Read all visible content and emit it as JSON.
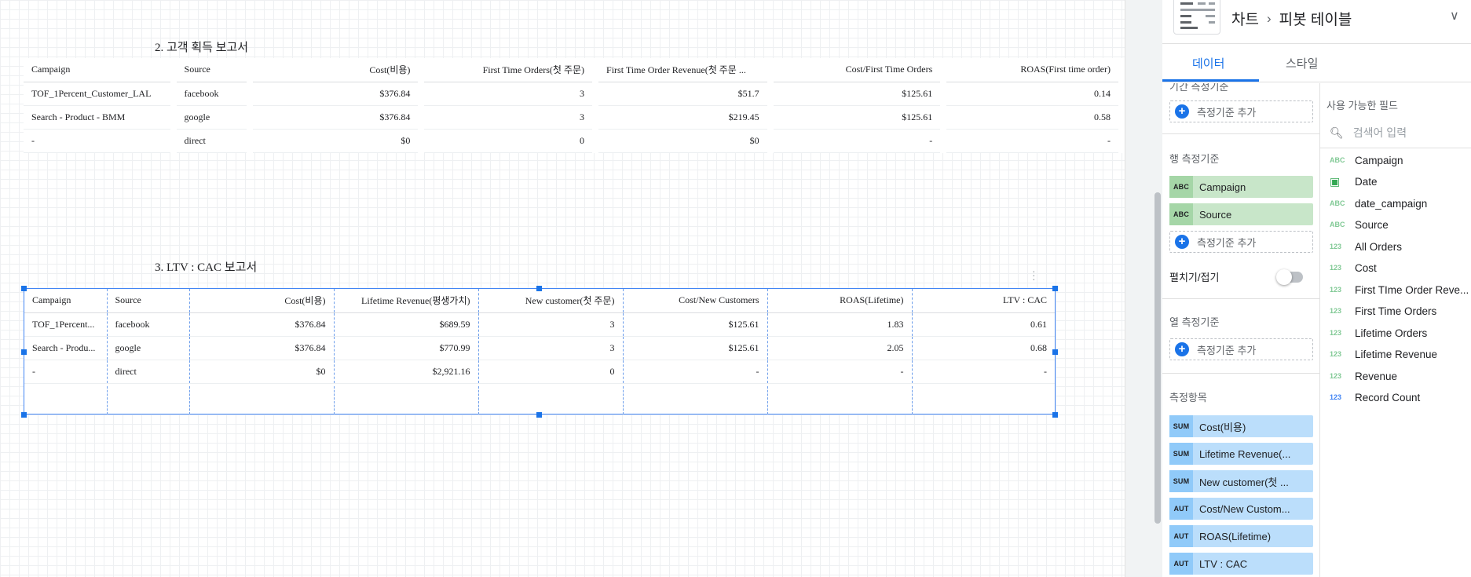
{
  "report2": {
    "title": "2. 고객 획득 보고서",
    "headers": [
      "Campaign",
      "Source",
      "Cost(비용)",
      "First Time Orders(첫 주문)",
      "First Time Order Revenue(첫 주문 ...",
      "Cost/First Time Orders",
      "ROAS(First time order)"
    ],
    "rows": [
      [
        "TOF_1Percent_Customer_LAL",
        "facebook",
        "$376.84",
        "3",
        "$51.7",
        "$125.61",
        "0.14"
      ],
      [
        "Search - Product - BMM",
        "google",
        "$376.84",
        "3",
        "$219.45",
        "$125.61",
        "0.58"
      ],
      [
        "-",
        "direct",
        "$0",
        "0",
        "$0",
        "-",
        "-"
      ]
    ]
  },
  "report3": {
    "title": "3. LTV : CAC 보고서",
    "headers": [
      "Campaign",
      "Source",
      "Cost(비용)",
      "Lifetime Revenue(평생가치)",
      "New customer(첫 주문)",
      "Cost/New Customers",
      "ROAS(Lifetime)",
      "LTV : CAC"
    ],
    "rows": [
      [
        "TOF_1Percent...",
        "facebook",
        "$376.84",
        "$689.59",
        "3",
        "$125.61",
        "1.83",
        "0.61"
      ],
      [
        "Search - Produ...",
        "google",
        "$376.84",
        "$770.99",
        "3",
        "$125.61",
        "2.05",
        "0.68"
      ],
      [
        "-",
        "direct",
        "$0",
        "$2,921.16",
        "0",
        "-",
        "-",
        "-"
      ]
    ]
  },
  "panel": {
    "breadcrumb_chart": "차트",
    "breadcrumb_sep": "›",
    "breadcrumb_type": "피봇 테이블",
    "collapse_icon": "∨",
    "tabs": {
      "data": "데이터",
      "style": "스타일"
    },
    "date_dimension_label": "기간 측정기준",
    "add_dimension": "측정기준 추가",
    "row_dimension_label": "행 측정기준",
    "row_dimensions": [
      {
        "badge": "ABC",
        "name": "Campaign"
      },
      {
        "badge": "ABC",
        "name": "Source"
      }
    ],
    "expand_collapse_label": "펼치기/접기",
    "column_dimension_label": "열 측정기준",
    "metrics_label": "측정항목",
    "metrics": [
      {
        "badge": "SUM",
        "name": "Cost(비용)"
      },
      {
        "badge": "SUM",
        "name": "Lifetime Revenue(..."
      },
      {
        "badge": "SUM",
        "name": "New customer(첫 ..."
      },
      {
        "badge": "AUT",
        "name": "Cost/New Custom..."
      },
      {
        "badge": "AUT",
        "name": "ROAS(Lifetime)"
      },
      {
        "badge": "AUT",
        "name": "LTV : CAC"
      }
    ],
    "available_fields_label": "사용 가능한 필드",
    "search_placeholder": "검색어 입력",
    "fields": [
      {
        "type": "ABC",
        "name": "Campaign"
      },
      {
        "type": "cal",
        "name": "Date"
      },
      {
        "type": "ABC",
        "name": "date_campaign"
      },
      {
        "type": "ABC",
        "name": "Source"
      },
      {
        "type": "123",
        "name": "All Orders"
      },
      {
        "type": "123",
        "name": "Cost"
      },
      {
        "type": "123",
        "name": "First TIme Order Reve..."
      },
      {
        "type": "123",
        "name": "First Time Orders"
      },
      {
        "type": "123",
        "name": "Lifetime Orders"
      },
      {
        "type": "123",
        "name": "Lifetime Revenue"
      },
      {
        "type": "123",
        "name": "Revenue"
      },
      {
        "type": "123",
        "name": "Record Count"
      }
    ]
  }
}
